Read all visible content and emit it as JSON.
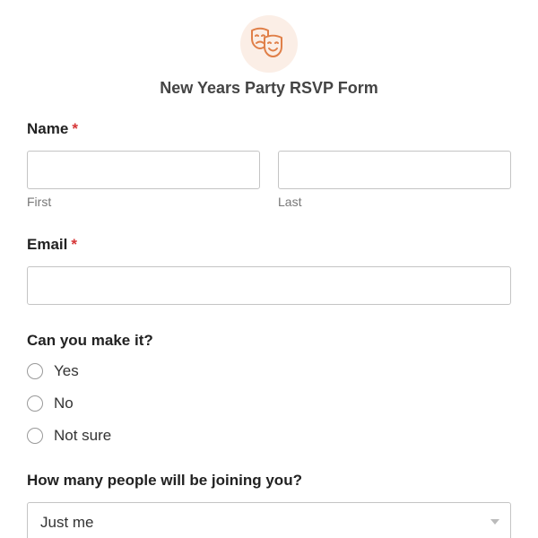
{
  "form": {
    "title": "New Years Party RSVP Form",
    "logo_icon": "theater-masks-icon",
    "accent_color": "#e07f48",
    "required_marker": "*"
  },
  "name_field": {
    "label": "Name",
    "first": {
      "value": "",
      "sublabel": "First"
    },
    "last": {
      "value": "",
      "sublabel": "Last"
    }
  },
  "email_field": {
    "label": "Email",
    "value": ""
  },
  "attendance": {
    "question": "Can you make it?",
    "options": [
      "Yes",
      "No",
      "Not sure"
    ]
  },
  "party_size": {
    "question": "How many people will be joining you?",
    "selected": "Just me"
  }
}
